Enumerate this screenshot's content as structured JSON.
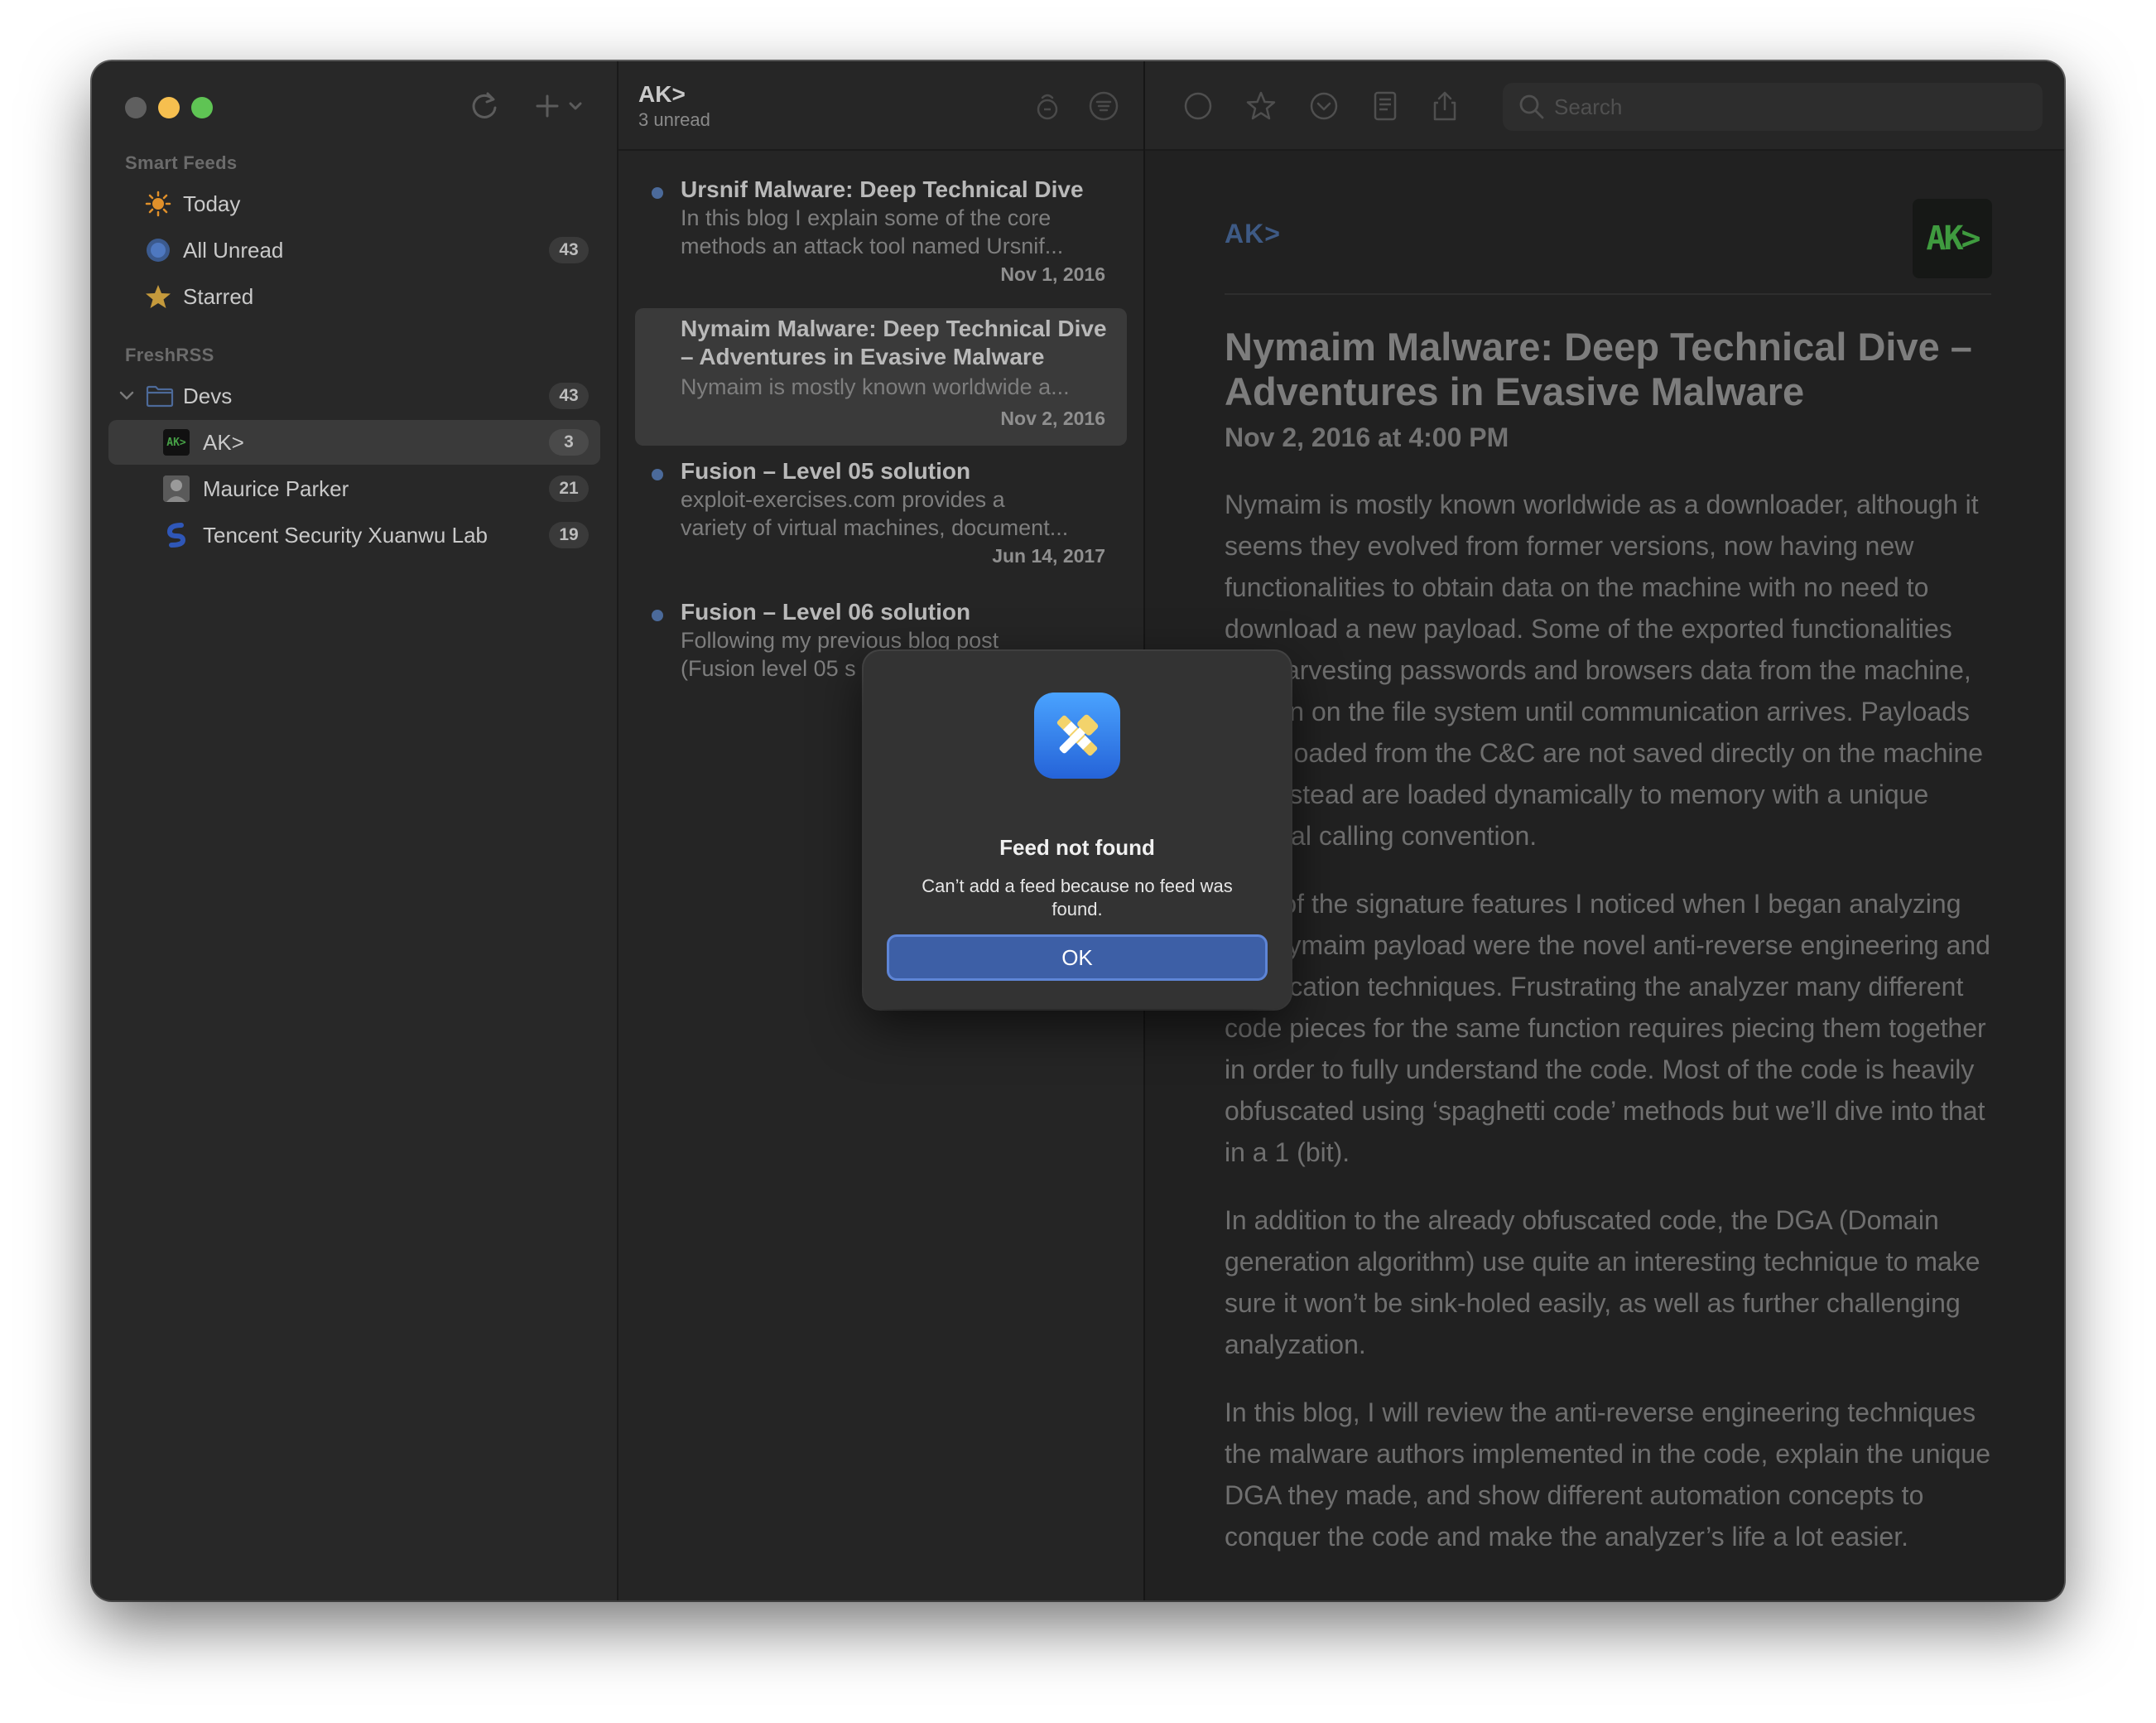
{
  "sidebar": {
    "sections": {
      "smart_feeds": "Smart Feeds",
      "freshrss": "FreshRSS"
    },
    "smart_items": [
      {
        "label": "Today",
        "icon": "sun-icon"
      },
      {
        "label": "All Unread",
        "icon": "unread-circle-icon",
        "count": "43"
      },
      {
        "label": "Starred",
        "icon": "star-icon"
      }
    ],
    "folder": {
      "label": "Devs",
      "count": "43"
    },
    "feeds": [
      {
        "label": "AK>",
        "count": "3",
        "icon": "ak-feed-icon",
        "selected": true
      },
      {
        "label": "Maurice Parker",
        "count": "21",
        "icon": "avatar-icon"
      },
      {
        "label": "Tencent Security Xuanwu Lab",
        "count": "19",
        "icon": "xuanwu-feed-icon"
      }
    ]
  },
  "list": {
    "title": "AK>",
    "subtitle": "3 unread",
    "items": [
      {
        "title": "Ursnif Malware: Deep Technical Dive",
        "summary1": "In this blog I explain some of the core",
        "summary2": "methods an attack tool named Ursnif...",
        "date": "Nov 1, 2016",
        "unread": true
      },
      {
        "title": "Nymaim Malware: Deep Technical Dive – Adventures in Evasive Malware",
        "summary1": "Nymaim is mostly known worldwide a...",
        "date": "Nov 2, 2016",
        "unread": false
      },
      {
        "title": "Fusion – Level 05 solution",
        "summary1": "exploit-exercises.com provides a",
        "summary2": "variety of virtual machines, document...",
        "date": "Jun 14, 2017",
        "unread": true
      },
      {
        "title": "Fusion – Level 06 solution",
        "summary1": "Following my previous blog post",
        "summary2": "(Fusion level 05 s",
        "unread": true
      }
    ]
  },
  "reader": {
    "search_placeholder": "Search",
    "feed_name": "AK>",
    "logo_text": "AK>",
    "title": "Nymaim Malware: Deep Technical Dive – Adventures in Evasive Malware",
    "date": "Nov 2, 2016 at 4:00 PM",
    "paragraphs": [
      "Nymaim is mostly known worldwide as a downloader, although it seems they evolved from former versions, now having new functionalities to obtain data on the machine with no need to download a new payload. Some of the exported functionalities are harvesting passwords and browsers data from the machine, hidden on the file system until communication arrives. Payloads downloaded from the C&C are not saved directly on the machine but instead are loaded dynamically to memory with a unique internal calling convention.",
      "One of the signature features I noticed when I began analyzing the Nymaim payload were the novel anti-reverse engineering and obfuscation techniques. Frustrating the analyzer many different code pieces for the same function requires piecing them together in order to fully understand the code. Most of the code is heavily obfuscated using ‘spaghetti code’ methods but we’ll dive into that in a 1 (bit).",
      "In addition to the already obfuscated code, the DGA (Domain generation algorithm) use quite an interesting technique to make sure it won’t be sink-holed easily, as well as further challenging analyzation.",
      "In this blog, I will review the anti-reverse engineering techniques the malware authors implemented in the code, explain the unique DGA they made, and show different automation concepts to conquer the code and make the analyzer’s life a lot easier."
    ]
  },
  "dialog": {
    "title": "Feed not found",
    "message": "Can’t add a feed because no feed was found.",
    "ok_label": "OK"
  },
  "colors": {
    "accent": "#3d5fa6",
    "unread_dot": "#4b6a9a",
    "sun": "#e0902a",
    "star": "#c59a3c",
    "traffic_yellow": "#f6bf4f",
    "traffic_green": "#5fc454"
  }
}
